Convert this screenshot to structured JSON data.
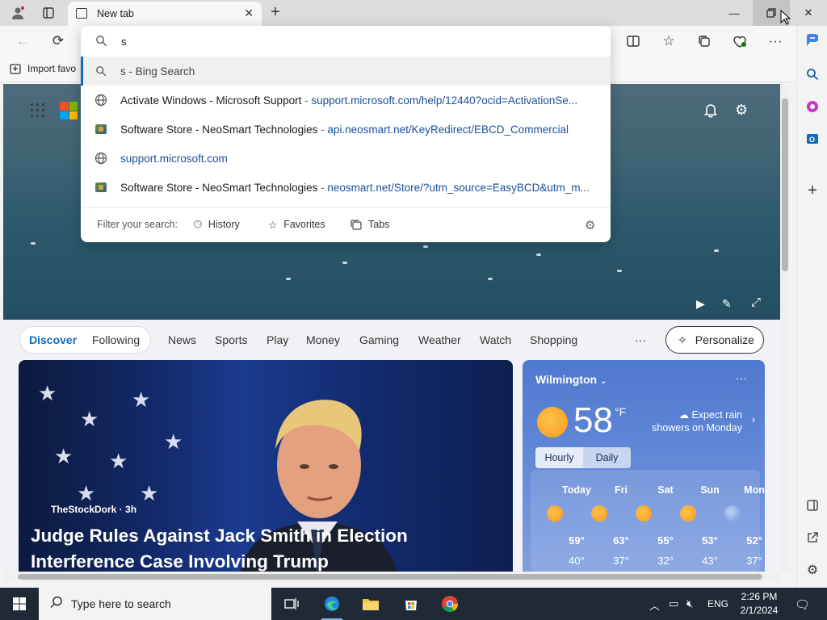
{
  "browser": {
    "tab_title": "New tab",
    "favorites_bar": {
      "import_label": "Import favo"
    }
  },
  "omnibox": {
    "query": "s",
    "suggestions": [
      {
        "title": "s - Bing Search",
        "url": "",
        "icon": "search-icon",
        "selected": true
      },
      {
        "title": "Activate Windows - Microsoft Support",
        "sep": " - ",
        "url": "support.microsoft.com/help/12440?ocid=ActivationSe...",
        "icon": "globe-icon",
        "selected": false
      },
      {
        "title": "Software Store - NeoSmart Technologies",
        "sep": " - ",
        "url": "api.neosmart.net/KeyRedirect/EBCD_Commercial",
        "icon": "neosmart-favicon",
        "selected": false
      },
      {
        "title": "support.microsoft.com",
        "url": "",
        "icon": "globe-icon",
        "selected": false
      },
      {
        "title": "Software Store - NeoSmart Technologies",
        "sep": " - ",
        "url": "neosmart.net/Store/?utm_source=EasyBCD&utm_m...",
        "icon": "neosmart-favicon",
        "selected": false
      }
    ],
    "filter": {
      "label": "Filter your search:",
      "history": "History",
      "favorites": "Favorites",
      "tabs": "Tabs"
    }
  },
  "newtab": {
    "topics": [
      "Discover",
      "Following",
      "News",
      "Sports",
      "Play",
      "Money",
      "Gaming",
      "Weather",
      "Watch",
      "Shopping"
    ],
    "more": "···",
    "personalize": "Personalize",
    "news": {
      "source": "TheStockDork · 3h",
      "headline": "Judge Rules Against Jack Smith in Election Interference Case Involving Trump"
    },
    "weather": {
      "city": "Wilmington",
      "temp": "58",
      "unit": "°F",
      "note": "Expect rain showers on Monday",
      "hourly": "Hourly",
      "daily": "Daily",
      "days": [
        {
          "name": "Today",
          "hi": "59°",
          "lo": "40°"
        },
        {
          "name": "Fri",
          "hi": "63°",
          "lo": "37°"
        },
        {
          "name": "Sat",
          "hi": "55°",
          "lo": "32°"
        },
        {
          "name": "Sun",
          "hi": "53°",
          "lo": "43°"
        },
        {
          "name": "Mon",
          "hi": "52°",
          "lo": "37°"
        }
      ]
    }
  },
  "taskbar": {
    "search_placeholder": "Type here to search",
    "language": "ENG",
    "time": "2:26 PM",
    "date": "2/1/2024"
  },
  "colors": {
    "accent": "#0f6cbd",
    "url_blue": "#1a4f9c",
    "taskbar": "#1f2a36"
  }
}
